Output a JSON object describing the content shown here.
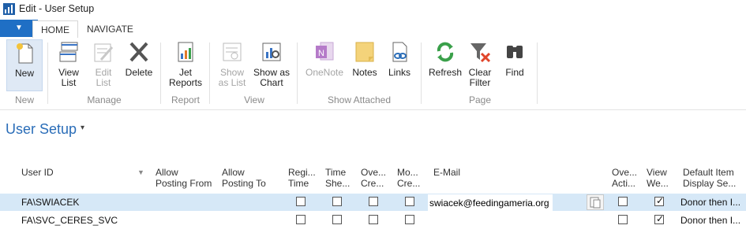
{
  "window": {
    "title": "Edit - User Setup"
  },
  "ribbon_tabs": {
    "menu_glyph": "▼",
    "home": "HOME",
    "navigate": "NAVIGATE"
  },
  "ribbon": {
    "new": "New",
    "view_list": "View\nList",
    "edit_list": "Edit\nList",
    "delete": "Delete",
    "jet_reports": "Jet\nReports",
    "show_as_list": "Show\nas List",
    "show_as_chart": "Show as\nChart",
    "onenote": "OneNote",
    "notes": "Notes",
    "links": "Links",
    "refresh": "Refresh",
    "clear_filter": "Clear\nFilter",
    "find": "Find",
    "groups": {
      "new": "New",
      "manage": "Manage",
      "report": "Report",
      "view": "View",
      "show_attached": "Show Attached",
      "page": "Page"
    }
  },
  "page": {
    "title": "User Setup",
    "title_chevron": "▾"
  },
  "table": {
    "headers": {
      "user_id": "User ID",
      "allow_from": "Allow\nPosting From",
      "allow_to": "Allow\nPosting To",
      "register_time": "Regi...\nTime",
      "time_sheet": "Time\nShe...",
      "overtime_create": "Ove...\nCre...",
      "mo_create": "Mo...\nCre...",
      "email": "E-Mail",
      "over_action": "Ove...\nActi...",
      "view_web": "View\nWe...",
      "default_item": "Default Item\nDisplay Se..."
    },
    "sort_glyph": "▼",
    "rows": [
      {
        "user_id": "FA\\SWIACEK",
        "email": "swiacek@feedingameria.org",
        "register_time": false,
        "time_sheet": false,
        "overtime_create": false,
        "mo_create": false,
        "over_action": false,
        "view_web": true,
        "default_item": "Donor then I..."
      },
      {
        "user_id": "FA\\SVC_CERES_SVC",
        "email": "",
        "register_time": false,
        "time_sheet": false,
        "overtime_create": false,
        "mo_create": false,
        "over_action": false,
        "view_web": true,
        "default_item": "Donor then I..."
      }
    ]
  }
}
